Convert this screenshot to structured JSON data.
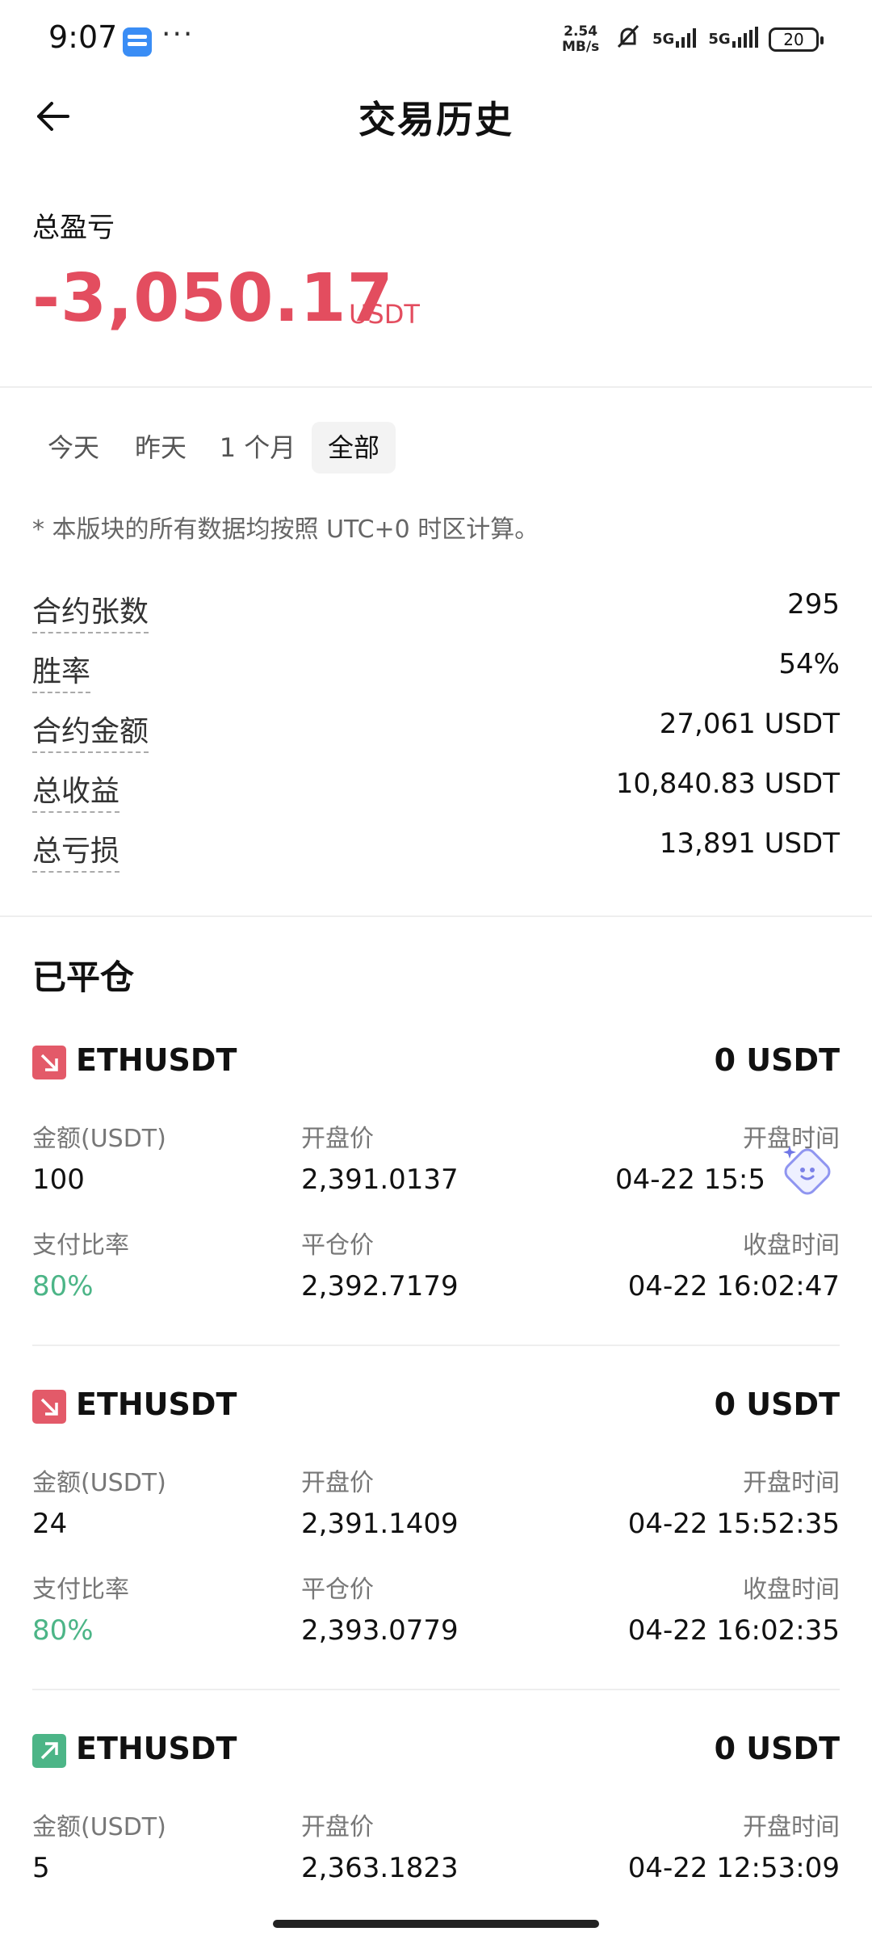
{
  "status_bar": {
    "time": "9:07",
    "dots": "···",
    "net_speed_value": "2.54",
    "net_speed_unit": "MB/s",
    "signal1": "5G",
    "signal2": "5G",
    "battery": "20"
  },
  "header": {
    "title": "交易历史"
  },
  "summary": {
    "label": "总盈亏",
    "value": "-3,050.17",
    "unit": "USDT"
  },
  "tabs": [
    {
      "label": "今天"
    },
    {
      "label": "昨天"
    },
    {
      "label": "1 个月"
    },
    {
      "label": "全部"
    }
  ],
  "active_tab": "全部",
  "note": "* 本版块的所有数据均按照 UTC+0 时区计算。",
  "stats": [
    {
      "label": "合约张数",
      "value": "295"
    },
    {
      "label": "胜率",
      "value": "54%"
    },
    {
      "label": "合约金额",
      "value": "27,061 USDT"
    },
    {
      "label": "总收益",
      "value": "10,840.83 USDT"
    },
    {
      "label": "总亏损",
      "value": "13,891 USDT"
    }
  ],
  "closed_section": {
    "title": "已平仓",
    "labels": {
      "amount": "金额(USDT)",
      "open_price": "开盘价",
      "open_time": "开盘时间",
      "payout": "支付比率",
      "close_price": "平仓价",
      "close_time": "收盘时间"
    },
    "trades": [
      {
        "direction": "down",
        "symbol": "ETHUSDT",
        "pnl": "0 USDT",
        "amount": "100",
        "open_price": "2,391.0137",
        "open_time": "04-22 15:5",
        "payout": "80%",
        "close_price": "2,392.7179",
        "close_time": "04-22 16:02:47"
      },
      {
        "direction": "down",
        "symbol": "ETHUSDT",
        "pnl": "0 USDT",
        "amount": "24",
        "open_price": "2,391.1409",
        "open_time": "04-22 15:52:35",
        "payout": "80%",
        "close_price": "2,393.0779",
        "close_time": "04-22 16:02:35"
      },
      {
        "direction": "up",
        "symbol": "ETHUSDT",
        "pnl": "0 USDT",
        "amount": "5",
        "open_price": "2,363.1823",
        "open_time": "04-22 12:53:09"
      }
    ]
  },
  "colors": {
    "loss": "#e34d5f",
    "gain": "#4cb587",
    "down_icon": "#e35a69",
    "up_icon": "#4cb587"
  },
  "icons": {
    "back": "arrow-left-icon",
    "down": "arrow-down-right-icon",
    "up": "arrow-up-right-icon",
    "assistant": "sparkle-assistant-icon"
  }
}
